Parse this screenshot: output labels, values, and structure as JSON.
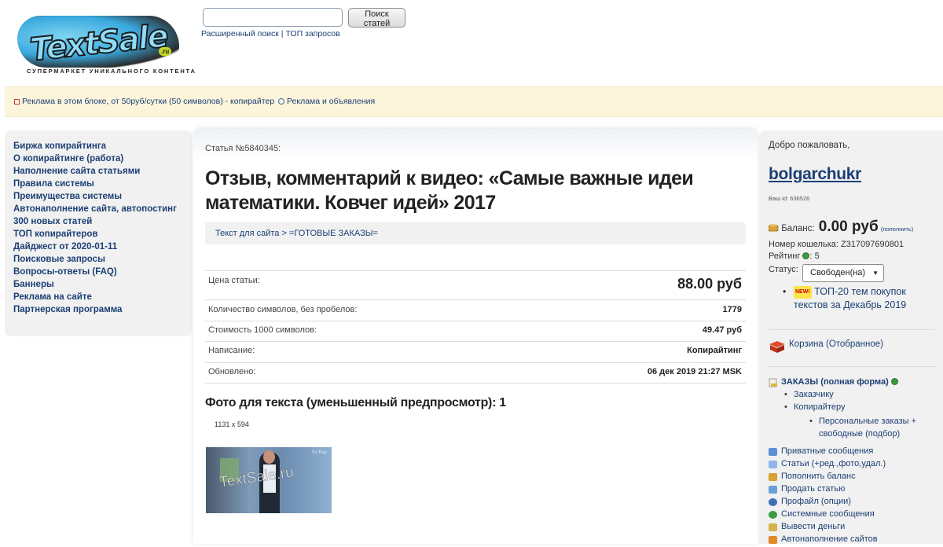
{
  "header": {
    "logo_text": "TextSale",
    "logo_suffix": ".ru",
    "tagline": "СУПЕРМАРКЕТ УНИКАЛЬНОГО КОНТЕНТА",
    "search_input_value": "",
    "search_button": "Поиск статей",
    "advanced_search": "Расширенный поиск",
    "link_separator": "|",
    "top_queries": "ТОП запросов"
  },
  "ad_band": {
    "ad_link": "Реклама в этом блоке, от 50руб/сутки (50 символов) - копирайтер",
    "ads_link": "Реклама и объявления"
  },
  "left_nav": [
    "Биржа копирайтинга",
    "О копирайтинге (работа)",
    "Наполнение сайта статьями",
    "Правила системы",
    "Преимущества системы",
    "Автонаполнение сайта, автопостинг",
    "300 новых статей",
    "ТОП копирайтеров",
    "Дайджест от 2020-01-11",
    "Поисковые запросы",
    "Вопросы-ответы (FAQ)",
    "Баннеры",
    "Реклама на сайте",
    "Партнерская программа"
  ],
  "article": {
    "number_label": "Статья №5840345:",
    "title": "Отзыв, комментарий к видео: «Самые важные идеи математики. Ковчег идей» 2017",
    "breadcrumb": "Текст для сайта > =ГОТОВЫЕ ЗАКАЗЫ=",
    "info": [
      {
        "label": "Цена статьи:",
        "value": "88.00 руб"
      },
      {
        "label": "Количество символов, без пробелов:",
        "value": "1779"
      },
      {
        "label": "Стоимость 1000 символов:",
        "value": "49.47 руб"
      },
      {
        "label": "Написание:",
        "value": "Копирайтинг"
      },
      {
        "label": "Обновлено:",
        "value": "06 дек 2019 21:27 MSK"
      }
    ],
    "photo_heading": "Фото для текста (уменьшенный предпросмотр): 1",
    "photo_dims": "1131 x 594",
    "photo_watermark": "TextSale.ru",
    "photo_corner_mark": "So Bay"
  },
  "sidebar": {
    "welcome": "Добро пожаловать,",
    "username": "bolgarchukr",
    "user_id": "Ваш id: 636526",
    "balance_label": "Баланс:",
    "balance_amount": "0.00 руб",
    "topup": "(пополнить)",
    "wallet": "Номер кошелька: Z317097690801",
    "rating_label": "Рейтинг",
    "rating_value": ": 5",
    "status_label": "Статус:",
    "status_value": "Свободен(на)",
    "new_badge": "NEW!",
    "top20": "ТОП-20 тем покупок текстов за Декабрь 2019",
    "cart": "Корзина (Отобранное)",
    "orders_title": "ЗАКАЗЫ (полная форма)",
    "orders_customer": "Заказчику",
    "orders_copywriter": "Копирайтеру",
    "orders_personal": "Персональные заказы + свободные (подбор)",
    "menu": [
      {
        "label": "Приватные сообщения",
        "icon": "message-icon",
        "color": "#5b8fd6"
      },
      {
        "label": "Статьи (+ред.,фото,удал.)",
        "icon": "articles-icon",
        "color": "#8fb7e8"
      },
      {
        "label": "Пополнить баланс",
        "icon": "topup-icon",
        "color": "#d7a033"
      },
      {
        "label": "Продать статью",
        "icon": "sell-icon",
        "color": "#6aa1d9"
      },
      {
        "label": "Профайл (опции)",
        "icon": "profile-icon",
        "color": "#3f6fb5"
      },
      {
        "label": "Системные сообщения",
        "icon": "system-messages-icon",
        "color": "#3a9b45"
      },
      {
        "label": "Вывести деньги",
        "icon": "withdraw-icon",
        "color": "#d5b24a"
      },
      {
        "label": "Автонаполнение сайтов",
        "icon": "autofill-icon",
        "color": "#e08a2a"
      }
    ]
  }
}
